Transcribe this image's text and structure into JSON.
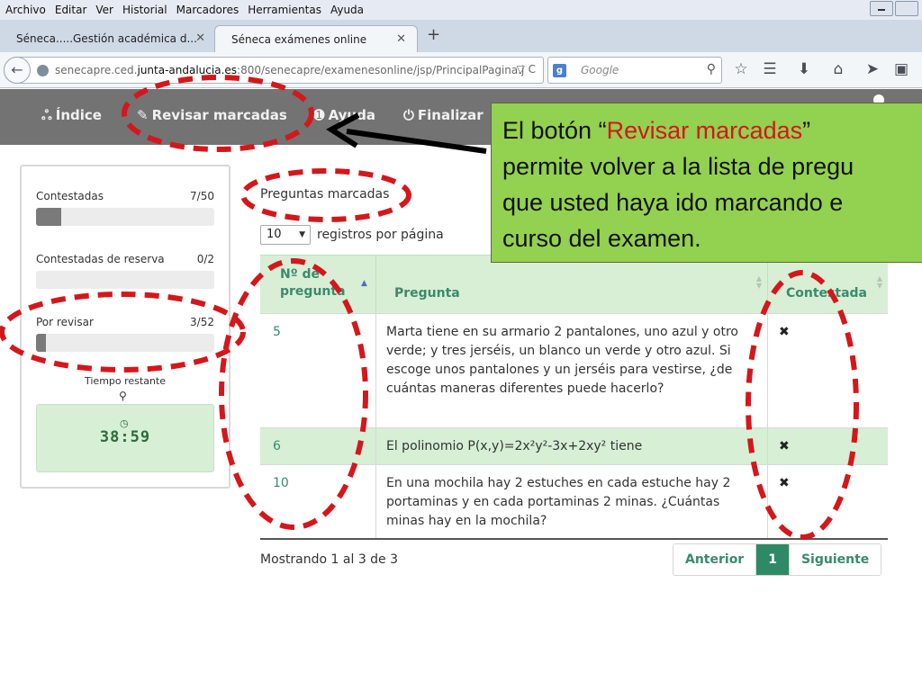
{
  "browser": {
    "menu": [
      "Archivo",
      "Editar",
      "Ver",
      "Historial",
      "Marcadores",
      "Herramientas",
      "Ayuda"
    ],
    "tabs": [
      {
        "label": "Séneca.....Gestión académica d..."
      },
      {
        "label": "Séneca exámenes online"
      }
    ],
    "url_prefix": "senecapre.ced.",
    "url_host": "junta-andalucia.es",
    "url_path": ":800/senecapre/examenesonline/jsp/PrincipalPagina.j",
    "search_engine": "Google",
    "search_placeholder": "Google"
  },
  "app": {
    "nav": [
      {
        "label": "Índice",
        "icon": "sitemap-icon"
      },
      {
        "label": "Revisar marcadas",
        "icon": "pencil-icon"
      },
      {
        "label": "Ayuda",
        "icon": "help-icon"
      },
      {
        "label": "Finalizar",
        "icon": "power-icon"
      }
    ]
  },
  "progress_panel": {
    "stats": [
      {
        "label": "Contestadas",
        "value": "7/50",
        "fraction": 0.14
      },
      {
        "label": "Contestadas de reserva",
        "value": "0/2",
        "fraction": 0.0
      },
      {
        "label": "Por revisar",
        "value": "3/52",
        "fraction": 0.058
      }
    ],
    "time_label": "Tiempo restante",
    "time_value": "38:59"
  },
  "content": {
    "title": "Preguntas marcadas",
    "page_length": "10",
    "page_length_label": "registros por página",
    "columns": [
      "Nº de pregunta",
      "Pregunta",
      "Contestada"
    ],
    "rows": [
      {
        "num": "5",
        "text": "Marta tiene en su armario 2 pantalones, uno azul y otro verde; y tres jerséis, un blanco un verde y otro azul. Si escoge unos pantalones y un jerséis para vestirse, ¿de cuántas maneras diferentes puede hacerlo?",
        "answered": "✖"
      },
      {
        "num": "6",
        "text": "El polinomio P(x,y)=2x²y²-3x+2xy² tiene",
        "answered": "✖"
      },
      {
        "num": "10",
        "text": "En una mochila hay 2 estuches en cada estuche hay 2 portaminas y en cada portaminas 2 minas. ¿Cuántas minas hay en la mochila?",
        "answered": "✖"
      }
    ],
    "showing": "Mostrando 1 al 3 de 3",
    "pager": {
      "prev": "Anterior",
      "current": "1",
      "next": "Siguiente"
    }
  },
  "callout": {
    "line1_a": "El   botón   “",
    "line1_red": "Revisar   marcadas",
    "line1_b": "”",
    "line2": "permite volver a la lista de pregu",
    "line3": "que  usted  haya  ido  marcando  e",
    "line4": "curso del examen."
  },
  "colors": {
    "annotation": "#d4171b",
    "callout_bg": "#93d150",
    "accent": "#2e8a66",
    "header_bg": "#737373"
  }
}
